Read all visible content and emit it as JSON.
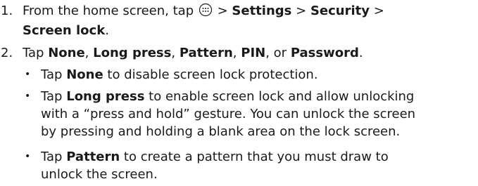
{
  "steps": [
    {
      "number": "1.",
      "t1": "From the home screen, tap",
      "icon": "apps-icon",
      "sep1": ">",
      "settings": "Settings",
      "sep2": ">",
      "security": "Security",
      "sep3": ">",
      "screen_lock": "Screen lock",
      "end": "."
    },
    {
      "number": "2.",
      "t1": "Tap",
      "none": "None",
      "c1": ",",
      "long_press": "Long press",
      "c2": ",",
      "pattern": "Pattern",
      "c3": ",",
      "pin": "PIN",
      "c4": ", or",
      "password": "Password",
      "end": "."
    }
  ],
  "bullets": [
    {
      "tap": "Tap",
      "option": "None",
      "rest": "to disable screen lock protection."
    },
    {
      "tap": "Tap",
      "option": "Long press",
      "rest_line1": "to enable screen lock and allow unlocking",
      "rest_line2": "with a “press and hold” gesture. You can unlock the screen",
      "rest_line3": "by pressing and holding a blank area on the lock screen."
    },
    {
      "tap": "Tap",
      "option": "Pattern",
      "rest_line1": "to create a pattern that you must draw to",
      "rest_line2": "unlock the screen."
    }
  ],
  "bullet_symbol": "•"
}
